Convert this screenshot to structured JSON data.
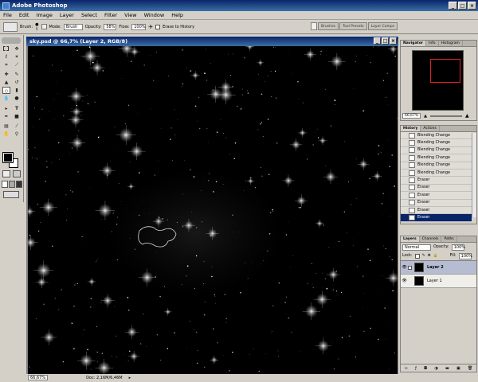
{
  "app": {
    "title": "Adobe Photoshop"
  },
  "window_buttons": [
    "_",
    "□",
    "×"
  ],
  "menu": [
    "File",
    "Edit",
    "Image",
    "Layer",
    "Select",
    "Filter",
    "View",
    "Window",
    "Help"
  ],
  "options": {
    "brush_label": "Brush:",
    "brush_size": "5",
    "mode_label": "Mode:",
    "mode_value": "Brush",
    "opacity_label": "Opacity:",
    "opacity_value": "58%",
    "flow_label": "Flow:",
    "flow_value": "100%",
    "erase_history": "Erase to History"
  },
  "palette_wells": [
    "Brushes",
    "Tool Presets",
    "Layer Comps"
  ],
  "document": {
    "title": "sky.psd @ 66,7% (Layer 2, RGB/8)",
    "zoom": "66,67%",
    "doc_size": "Doc: 2,16M/6,46M"
  },
  "navigator": {
    "tabs": [
      "Navigator",
      "Info",
      "Histogram"
    ],
    "zoom": "66,67%"
  },
  "history": {
    "tabs": [
      "History",
      "Actions"
    ],
    "items": [
      {
        "label": "Blending Change",
        "icon": "doc-icon"
      },
      {
        "label": "Blending Change",
        "icon": "doc-icon"
      },
      {
        "label": "Blending Change",
        "icon": "doc-icon"
      },
      {
        "label": "Blending Change",
        "icon": "doc-icon"
      },
      {
        "label": "Blending Change",
        "icon": "doc-icon"
      },
      {
        "label": "Blending Change",
        "icon": "doc-icon"
      },
      {
        "label": "Eraser",
        "icon": "eraser-icon"
      },
      {
        "label": "Eraser",
        "icon": "eraser-icon"
      },
      {
        "label": "Eraser",
        "icon": "eraser-icon"
      },
      {
        "label": "Eraser",
        "icon": "eraser-icon"
      },
      {
        "label": "Eraser",
        "icon": "eraser-icon"
      },
      {
        "label": "Eraser",
        "icon": "eraser-icon"
      }
    ]
  },
  "layers": {
    "tabs": [
      "Layers",
      "Channels",
      "Paths"
    ],
    "blend_mode": "Normal",
    "opacity_label": "Opacity:",
    "opacity_value": "100%",
    "lock_label": "Lock:",
    "fill_label": "Fill:",
    "fill_value": "100%",
    "items": [
      {
        "name": "Layer 2",
        "selected": true
      },
      {
        "name": "Layer 1",
        "selected": false
      }
    ]
  }
}
